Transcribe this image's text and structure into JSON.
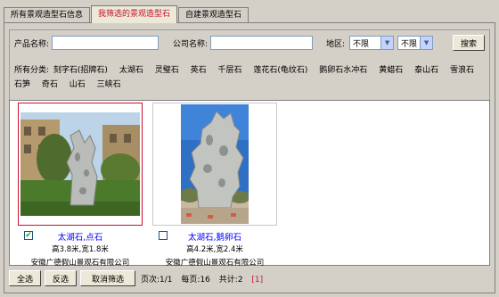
{
  "tabs": [
    {
      "label": "所有景观造型石信息"
    },
    {
      "label": "我筛选的景观造型石"
    },
    {
      "label": "自建景观造型石"
    }
  ],
  "filter": {
    "product_label": "产品名称:",
    "product_value": "",
    "company_label": "公司名称:",
    "company_value": "",
    "region_label": "地区:",
    "region_province": "不限",
    "region_city": "不限",
    "search_button": "搜索"
  },
  "categories": {
    "label": "所有分类:",
    "items": [
      "刻字石(招牌石)",
      "太湖石",
      "灵璧石",
      "英石",
      "千层石",
      "莲花石(龟纹石)",
      "鹅卵石水冲石",
      "黄蜡石",
      "泰山石",
      "雪浪石",
      "石笋",
      "奇石",
      "山石",
      "三峡石"
    ]
  },
  "results": [
    {
      "title": "太湖石,点石",
      "dims": "高3.8米,宽1.8米",
      "company": "安徽广德假山景观石有限公司",
      "checked": true,
      "check_glyph": "✔"
    },
    {
      "title": "太湖石,鹅卵石",
      "dims": "高4.2米,宽2.4米",
      "company": "安徽广德假山景观石有限公司",
      "checked": false,
      "check_glyph": ""
    }
  ],
  "bottom": {
    "select_all": "全选",
    "invert": "反选",
    "cancel_filter": "取消筛选",
    "page_info": "页次:1/1",
    "per_page": "每页:16",
    "total": "共计:2",
    "page_link": "[1]"
  },
  "colors": {
    "background": "#d4d0c8",
    "active_tab_text": "#c8102e",
    "title_link": "#0000ff",
    "selected_border": "#c8102e"
  }
}
